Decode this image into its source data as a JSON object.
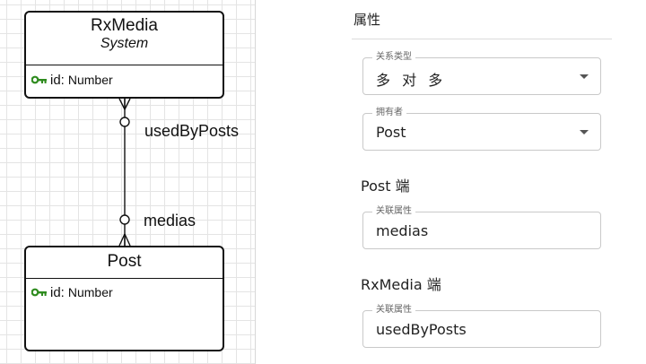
{
  "diagram": {
    "entities": [
      {
        "name": "RxMedia",
        "stereotype": "System",
        "attributes": [
          {
            "name": "id:",
            "type": "Number",
            "icon": "key-icon"
          }
        ]
      },
      {
        "name": "Post",
        "attributes": [
          {
            "name": "id:",
            "type": "Number",
            "icon": "key-icon"
          }
        ]
      }
    ],
    "relation": {
      "label_top": "usedByPosts",
      "label_bottom": "medias"
    },
    "colors": {
      "key": "#2e8b1e",
      "grid": "#e4e4e4",
      "stroke": "#111111"
    }
  },
  "panel": {
    "title": "属性",
    "relation_type": {
      "legend": "关系类型",
      "value": "多 对 多"
    },
    "owner": {
      "legend": "拥有者",
      "value": "Post"
    },
    "post_side": {
      "title": "Post 端",
      "field": {
        "legend": "关联属性",
        "value": "medias"
      }
    },
    "rxmedia_side": {
      "title": "RxMedia 端",
      "field": {
        "legend": "关联属性",
        "value": "usedByPosts"
      }
    }
  }
}
